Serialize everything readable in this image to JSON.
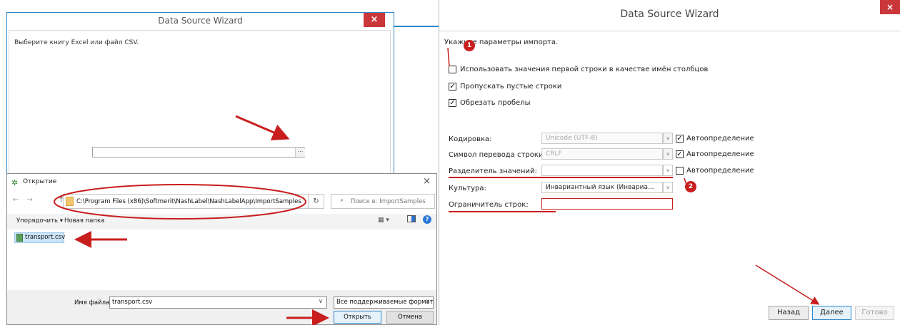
{
  "colors": {
    "accent": "#2d87c8",
    "close": "#c9373b",
    "annotation": "#c81e1e"
  },
  "left_wizard": {
    "title": "Data Source Wizard",
    "close": "×",
    "instruction": "Выберите книгу Excel или файл CSV.",
    "browse_label": "..."
  },
  "open_dialog": {
    "title": "Открытие",
    "close": "×",
    "nav_arrows": "← →",
    "up": "↑",
    "address": "C:\\Program Files (x86)\\Softmerit\\NashLabel\\NashLabelApp\\ImportSamples",
    "refresh": "↻",
    "search_placeholder": "Поиск в: ImportSamples",
    "organize": "Упорядочить ▾",
    "new_folder": "Новая папка",
    "view": "▦ ▾",
    "help": "?",
    "file": "transport.csv",
    "filename_label": "Имя файла:",
    "filename_value": "transport.csv",
    "filetype_value": "Все поддерживаемые формат",
    "dropdown_arrow": "∨",
    "open_button": "Открыть",
    "cancel_button": "Отмена"
  },
  "right_wizard": {
    "title": "Data Source Wizard",
    "close": "×",
    "instruction": "Укажите параметры импорта.",
    "options": [
      {
        "label": "Использовать значения первой строки в качестве имён столбцов",
        "checked": false
      },
      {
        "label": "Пропускать пустые строки",
        "checked": true
      },
      {
        "label": "Обрезать пробелы",
        "checked": true
      }
    ],
    "fields": [
      {
        "label": "Кодировка:",
        "value": "Unicode (UTF-8)",
        "auto_label": "Автоопределение",
        "auto_checked": true,
        "disabled": true
      },
      {
        "label": "Символ перевода строки:",
        "value": "CRLF",
        "auto_label": "Автоопределение",
        "auto_checked": true,
        "disabled": true
      },
      {
        "label": "Разделитель значений:",
        "value": "",
        "auto_label": "Автоопределение",
        "auto_checked": false,
        "disabled": false
      },
      {
        "label": "Культура:",
        "value": "Инвариантный язык (Инвариа...",
        "disabled": false
      },
      {
        "label": "Ограничитель строк:",
        "value": "",
        "disabled": false
      }
    ],
    "check_mark": "✓",
    "back_button": "Назад",
    "next_button": "Далее",
    "finish_button": "Готово"
  },
  "annotations": {
    "badge1": "1",
    "badge2": "2"
  }
}
